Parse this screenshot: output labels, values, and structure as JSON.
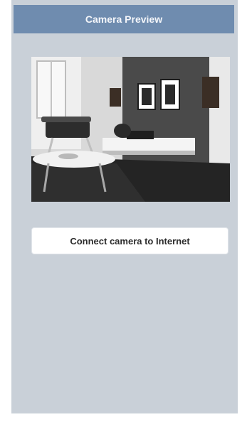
{
  "header": {
    "title": "Camera Preview"
  },
  "preview": {
    "image": "camera-preview-image"
  },
  "actions": {
    "connect_label": "Connect camera to Internet"
  },
  "colors": {
    "header_bg": "#6f8caf",
    "screen_bg": "#c9d0d8",
    "button_bg": "#ffffff"
  }
}
